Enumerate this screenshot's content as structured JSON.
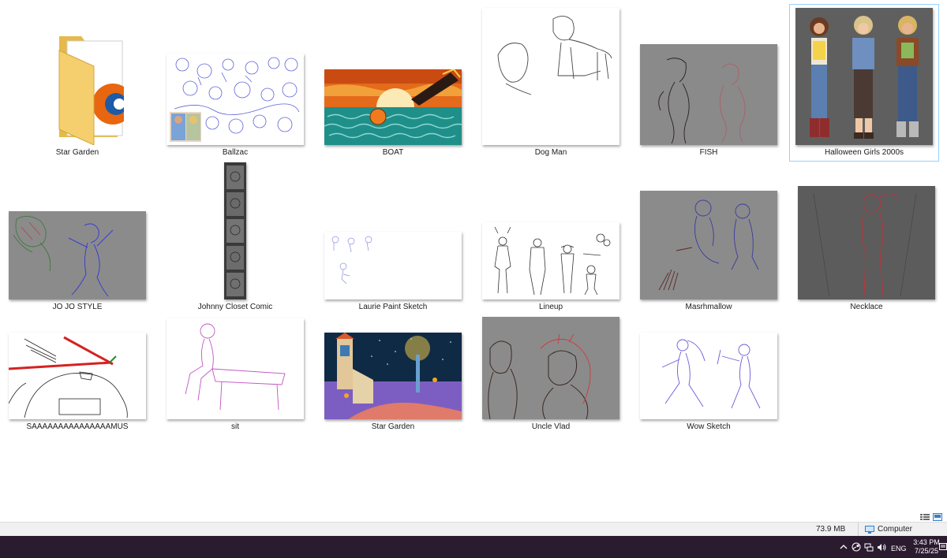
{
  "folder_items": [
    {
      "label": "Star Garden",
      "type": "folder",
      "icon": "folder-icon"
    },
    {
      "label": "Ballzac",
      "type": "image"
    },
    {
      "label": "BOAT",
      "type": "image"
    },
    {
      "label": "Dog Man",
      "type": "image"
    },
    {
      "label": "FISH",
      "type": "image"
    },
    {
      "label": "Halloween Girls 2000s",
      "type": "image",
      "selected": true
    },
    {
      "label": "JO JO STYLE",
      "type": "image"
    },
    {
      "label": "Johnny Closet Comic",
      "type": "image"
    },
    {
      "label": "Laurie Paint Sketch",
      "type": "image"
    },
    {
      "label": "Lineup",
      "type": "image"
    },
    {
      "label": "Masrhmallow",
      "type": "image"
    },
    {
      "label": "Necklace",
      "type": "image"
    },
    {
      "label": "SAAAAAAAAAAAAAAAMUS",
      "type": "image"
    },
    {
      "label": "sit",
      "type": "image"
    },
    {
      "label": "Star Garden",
      "type": "image"
    },
    {
      "label": "Uncle Vlad",
      "type": "image"
    },
    {
      "label": "Wow Sketch",
      "type": "image"
    }
  ],
  "status_bar": {
    "selected_size": "73.9 MB",
    "location": "Computer",
    "location_icon": "computer-icon"
  },
  "view_buttons": [
    {
      "icon": "details-view-icon"
    },
    {
      "icon": "large-icons-view-icon"
    }
  ],
  "taskbar": {
    "tray_icons": [
      "chevron-up-icon",
      "steam-icon",
      "network-icon",
      "volume-icon",
      "action-center-icon"
    ],
    "language": "ENG",
    "time": "3:43 PM",
    "date": "7/25/25",
    "colors": {
      "background": "#2b1b2f"
    }
  }
}
